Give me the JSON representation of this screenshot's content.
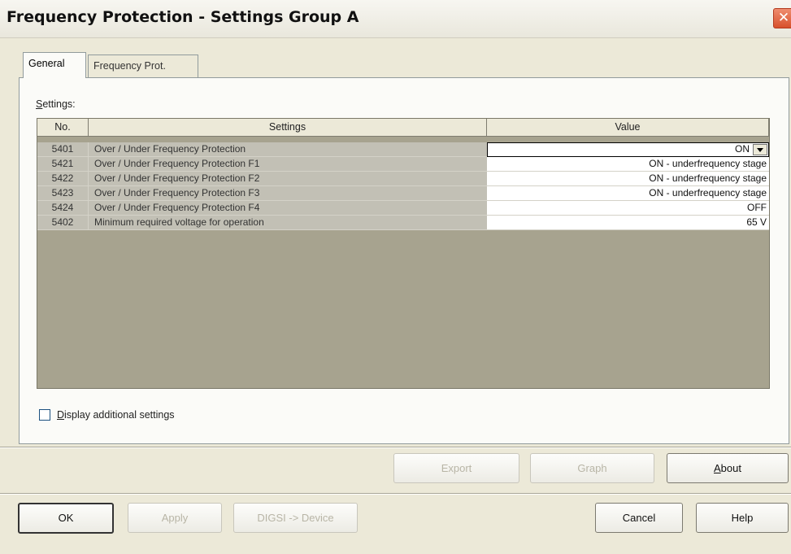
{
  "window": {
    "title": "Frequency Protection - Settings Group A",
    "close_icon": "close-icon"
  },
  "tabs": [
    {
      "label": "General",
      "active": true
    },
    {
      "label": "Frequency Prot.",
      "active": false
    }
  ],
  "settings_label": "Settings:",
  "table": {
    "headers": {
      "no": "No.",
      "settings": "Settings",
      "value": "Value"
    },
    "rows": [
      {
        "no": "5401",
        "setting": "Over / Under Frequency Protection",
        "value": "ON"
      },
      {
        "no": "5421",
        "setting": "Over / Under Frequency Protection F1",
        "value": "ON - underfrequency stage"
      },
      {
        "no": "5422",
        "setting": "Over / Under Frequency Protection F2",
        "value": "ON - underfrequency stage"
      },
      {
        "no": "5423",
        "setting": "Over / Under Frequency Protection F3",
        "value": "ON - underfrequency stage"
      },
      {
        "no": "5424",
        "setting": "Over / Under Frequency Protection F4",
        "value": "OFF"
      },
      {
        "no": "5402",
        "setting": "Minimum required voltage for operation",
        "value": "65 V"
      }
    ]
  },
  "additional_settings": {
    "label": "Display additional settings",
    "checked": false
  },
  "buttons": {
    "export": "Export",
    "graph": "Graph",
    "about": "About",
    "ok": "OK",
    "apply": "Apply",
    "digsi": "DIGSI -> Device",
    "cancel": "Cancel",
    "help": "Help"
  },
  "colors": {
    "grid_background": "#a7a38f",
    "dialog_background": "#ece9d8",
    "close_button": "#d8502c"
  }
}
